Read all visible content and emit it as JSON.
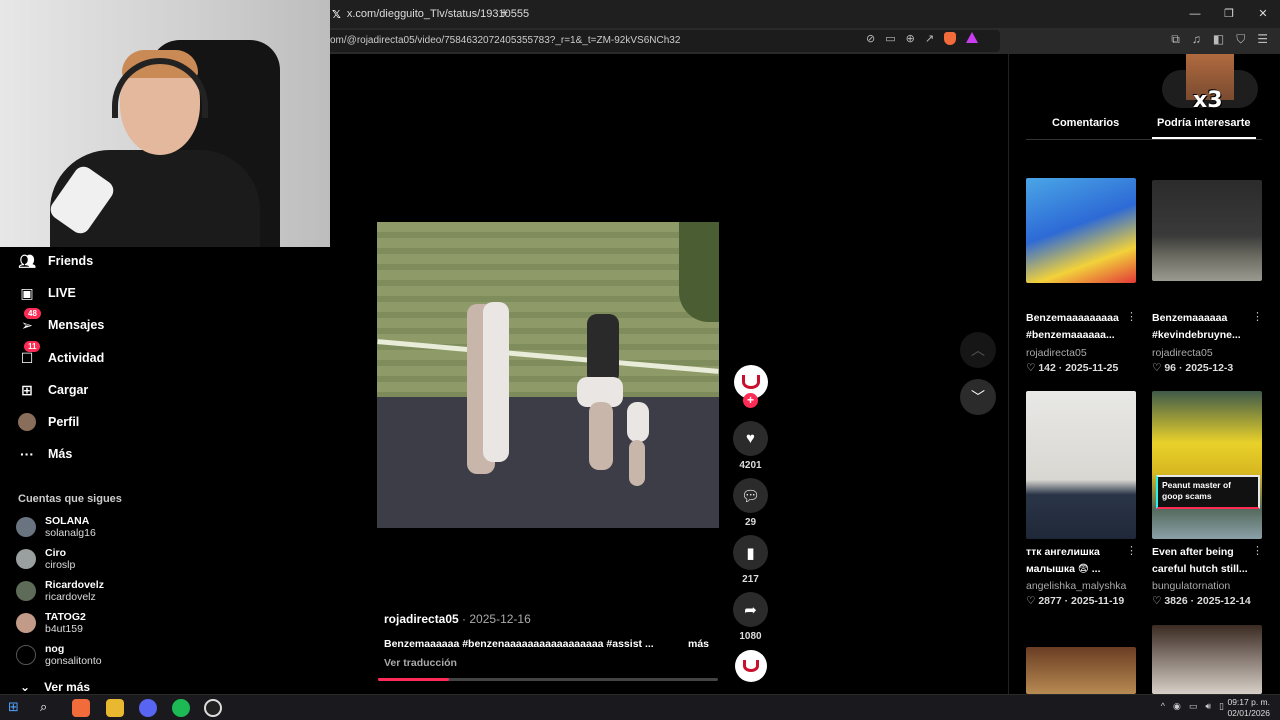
{
  "browser": {
    "tab_title": "x.com/diegguito_Tlv/status/19310555",
    "new_tab": "+",
    "url": "om/@rojadirecta05/video/7584632072405355783?_r=1&_t=ZM-92kVS6NCh32",
    "window_controls": [
      "—",
      "❐",
      "✕"
    ]
  },
  "nav": {
    "items": [
      {
        "label": "Friends",
        "icon": "friends-icon",
        "badge": ""
      },
      {
        "label": "LIVE",
        "icon": "live-icon",
        "badge": ""
      },
      {
        "label": "Mensajes",
        "icon": "messages-icon",
        "badge": "48"
      },
      {
        "label": "Actividad",
        "icon": "activity-icon",
        "badge": "11"
      },
      {
        "label": "Cargar",
        "icon": "upload-icon",
        "badge": ""
      },
      {
        "label": "Perfil",
        "icon": "profile-icon",
        "badge": ""
      },
      {
        "label": "Más",
        "icon": "more-icon",
        "badge": ""
      }
    ],
    "following_title": "Cuentas que sigues",
    "following": [
      {
        "name": "SOLANA",
        "handle": "solanalg16"
      },
      {
        "name": "Ciro",
        "handle": "ciroslp"
      },
      {
        "name": "Ricardovelz",
        "handle": "ricardovelz"
      },
      {
        "name": "TATOG2",
        "handle": "b4ut159"
      },
      {
        "name": "nog",
        "handle": "gonsalitonto"
      }
    ],
    "see_more": "Ver más"
  },
  "post": {
    "author": "rojadirecta05",
    "date": " · 2025-12-16",
    "description": "Benzemaaaaaa #benzenaaaaaaaaaaaaaaaaa #assist ...",
    "more": "más",
    "translate": "Ver traducción",
    "progress": 0.21
  },
  "actions": {
    "likes": "4201",
    "comments": "29",
    "saves": "217",
    "shares": "1080"
  },
  "right_panel": {
    "reaction_label": "x3",
    "tabs": [
      "Comentarios",
      "Podría interesarte"
    ],
    "cards": [
      {
        "title": "Benzemaaaaaaaaa #benzemaaaaaa...",
        "author": "rojadirecta05",
        "likes": "142",
        "date": "2025-11-25"
      },
      {
        "title": "Benzemaaaaaa #kevindebruyne...",
        "author": "rojadirecta05",
        "likes": "96",
        "date": "2025-12-3"
      },
      {
        "title": "ттк ангелишка малышка 😨 ...",
        "author": "angelishka_malyshka",
        "likes": "2877",
        "date": "2025-11-19"
      },
      {
        "title": "Even after being careful hutch still...",
        "author": "bungulatornation",
        "likes": "3826",
        "date": "2025-12-14"
      }
    ],
    "overlay_caption": "Peanut master of goop scams"
  },
  "taskbar": {
    "time": "09:17 p. m.",
    "date": "02/01/2026"
  }
}
